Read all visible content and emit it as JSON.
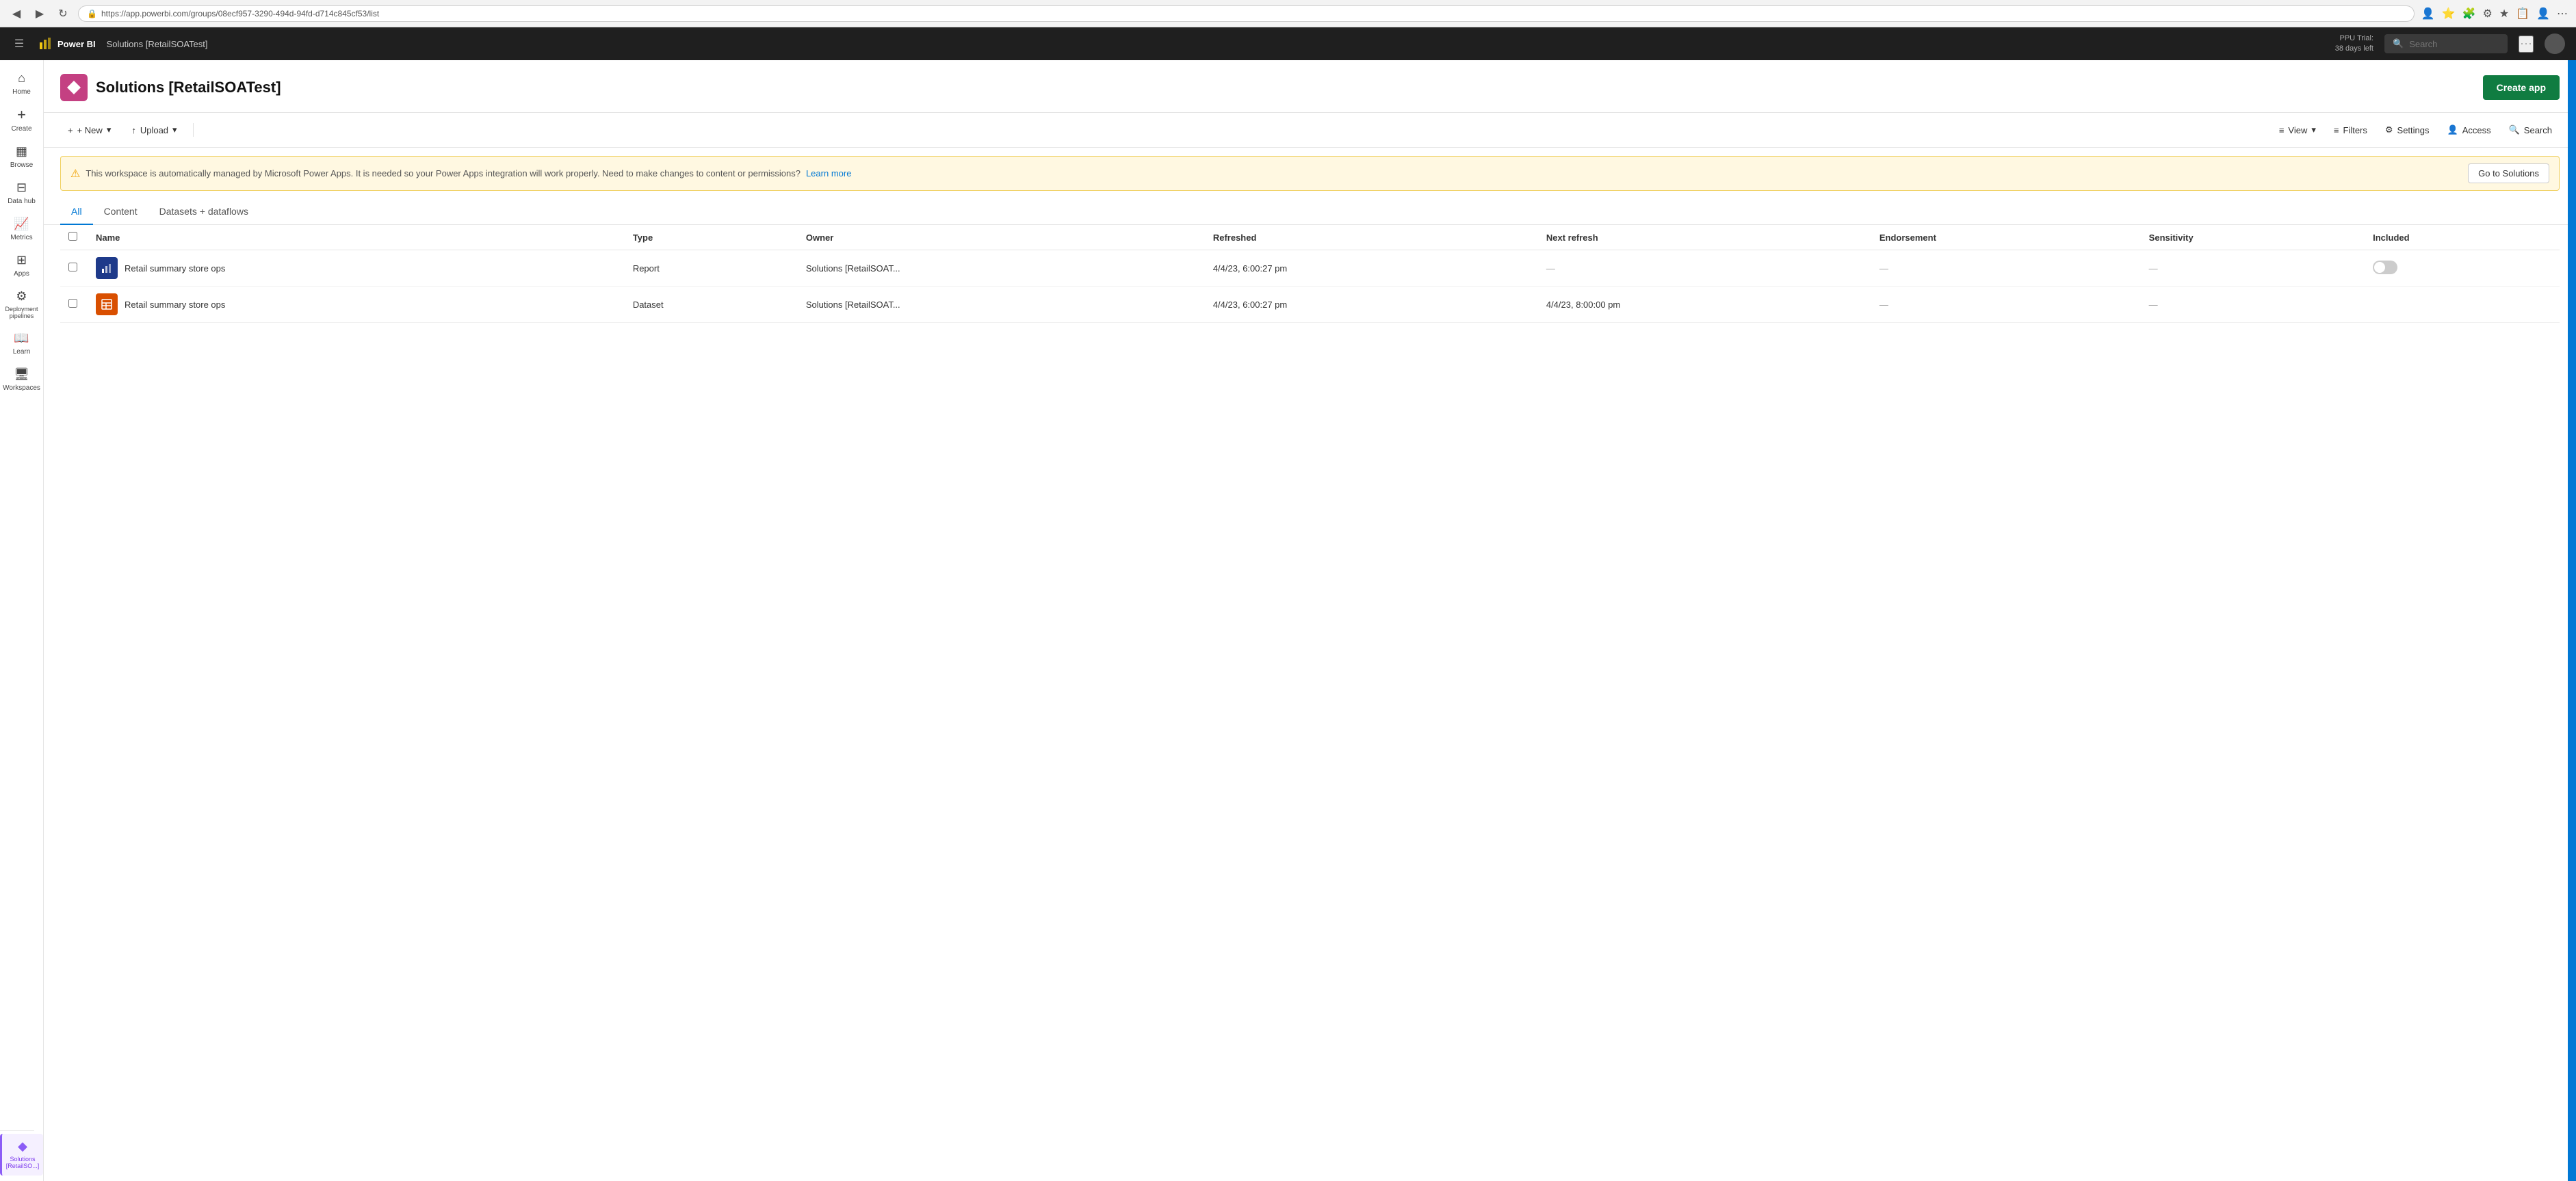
{
  "browser": {
    "url": "https://app.powerbi.com/groups/08ecf957-3290-494d-94fd-d714c845cf53/list",
    "back_icon": "◀",
    "forward_icon": "▶",
    "refresh_icon": "↻",
    "more_icon": "⋯"
  },
  "topnav": {
    "logo": "Power BI",
    "workspace": "Solutions [RetailSOATest]",
    "ppu_line1": "PPU Trial:",
    "ppu_line2": "38 days left",
    "search_placeholder": "Search",
    "more_icon": "⋯",
    "avatar_initials": ""
  },
  "sidebar": {
    "items": [
      {
        "id": "home",
        "icon": "⌂",
        "label": "Home"
      },
      {
        "id": "create",
        "icon": "+",
        "label": "Create"
      },
      {
        "id": "browse",
        "icon": "⊞",
        "label": "Browse"
      },
      {
        "id": "datahub",
        "icon": "⊟",
        "label": "Data hub"
      },
      {
        "id": "metrics",
        "icon": "↑",
        "label": "Metrics"
      },
      {
        "id": "apps",
        "icon": "⊞",
        "label": "Apps"
      },
      {
        "id": "deployment",
        "icon": "⚙",
        "label": "Deployment pipelines"
      },
      {
        "id": "learn",
        "icon": "📖",
        "label": "Learn"
      },
      {
        "id": "workspaces",
        "icon": "🖥",
        "label": "Workspaces"
      }
    ],
    "bottom": {
      "id": "solutions",
      "icon": "◆",
      "label": "Solutions [RetailSO...]"
    }
  },
  "pageheader": {
    "title": "Solutions [RetailSOATest]",
    "create_app_label": "Create app"
  },
  "toolbar": {
    "new_label": "+ New",
    "new_chevron": "▾",
    "upload_label": "↑ Upload",
    "upload_chevron": "▾",
    "view_label": "View",
    "view_icon": "≡",
    "filters_label": "Filters",
    "filters_icon": "≡",
    "settings_label": "Settings",
    "settings_icon": "⚙",
    "access_label": "Access",
    "access_icon": "👤",
    "search_label": "Search",
    "search_icon": "🔍"
  },
  "banner": {
    "warning_icon": "⚠",
    "message": "This workspace is automatically managed by Microsoft Power Apps. It is needed so your Power Apps integration will work properly. Need to make changes to content or permissions?",
    "link_text": "Learn more",
    "button_label": "Go to Solutions"
  },
  "tabs": [
    {
      "id": "all",
      "label": "All",
      "active": true
    },
    {
      "id": "content",
      "label": "Content",
      "active": false
    },
    {
      "id": "datasets",
      "label": "Datasets + dataflows",
      "active": false
    }
  ],
  "table": {
    "columns": [
      {
        "id": "name",
        "label": "Name"
      },
      {
        "id": "type",
        "label": "Type"
      },
      {
        "id": "owner",
        "label": "Owner"
      },
      {
        "id": "refreshed",
        "label": "Refreshed"
      },
      {
        "id": "next_refresh",
        "label": "Next refresh"
      },
      {
        "id": "endorsement",
        "label": "Endorsement"
      },
      {
        "id": "sensitivity",
        "label": "Sensitivity"
      },
      {
        "id": "included",
        "label": "Included"
      }
    ],
    "rows": [
      {
        "icon_type": "report",
        "name": "Retail summary store ops",
        "type": "Report",
        "owner": "Solutions [RetailSOAT...",
        "refreshed": "4/4/23, 6:00:27 pm",
        "next_refresh": "—",
        "endorsement": "—",
        "sensitivity": "—",
        "included": "toggle_off"
      },
      {
        "icon_type": "dataset",
        "name": "Retail summary store ops",
        "type": "Dataset",
        "owner": "Solutions [RetailSOAT...",
        "refreshed": "4/4/23, 6:00:27 pm",
        "next_refresh": "4/4/23, 8:00:00 pm",
        "endorsement": "—",
        "sensitivity": "—",
        "included": ""
      }
    ]
  },
  "colors": {
    "accent_blue": "#0078d4",
    "accent_green": "#107c41",
    "accent_purple": "#8b5cf6",
    "report_icon_bg": "#1e3a8a",
    "dataset_icon_bg": "#d94f00",
    "workspace_icon_bg": "#c44082"
  }
}
